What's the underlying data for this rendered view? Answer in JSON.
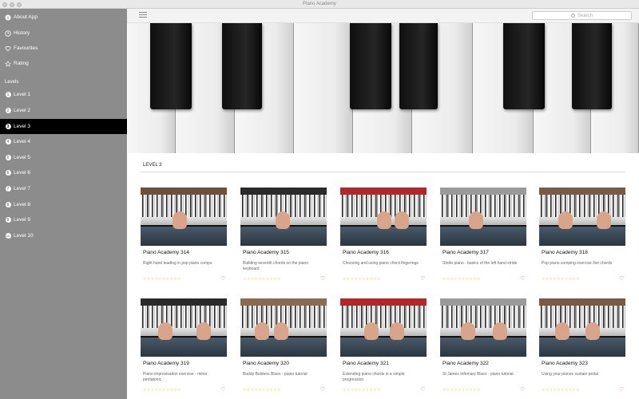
{
  "window": {
    "title": "Piano Academy"
  },
  "toolbar": {
    "search_placeholder": "Search"
  },
  "sidebar": {
    "top_items": [
      {
        "label": "About App",
        "icon": "info-icon"
      },
      {
        "label": "History",
        "icon": "clock-icon"
      },
      {
        "label": "Favourites",
        "icon": "heart-icon"
      },
      {
        "label": "Rating",
        "icon": "star-icon"
      }
    ],
    "levels_header": "Levels",
    "levels": [
      {
        "label": "Level 1",
        "num": "1",
        "active": false
      },
      {
        "label": "Level 2",
        "num": "2",
        "active": false
      },
      {
        "label": "Level 3",
        "num": "3",
        "active": true
      },
      {
        "label": "Level 4",
        "num": "4",
        "active": false
      },
      {
        "label": "Level 5",
        "num": "5",
        "active": false
      },
      {
        "label": "Level 6",
        "num": "6",
        "active": false
      },
      {
        "label": "Level 7",
        "num": "7",
        "active": false
      },
      {
        "label": "Level 8",
        "num": "8",
        "active": false
      },
      {
        "label": "Level 9",
        "num": "9",
        "active": false
      },
      {
        "label": "Level 10",
        "num": "10",
        "active": false
      }
    ]
  },
  "main": {
    "section_title": "LEVEL 3",
    "stars": "☆☆☆☆☆☆☆☆☆☆",
    "fav_symbol": "♡",
    "cards": [
      {
        "title": "Piano Academy 314",
        "description": "Right hand leading in pop piano comps",
        "rating": 0
      },
      {
        "title": "Piano Academy 315",
        "description": "Building seventh chords on the piano keyboard",
        "rating": 0
      },
      {
        "title": "Piano Academy 316",
        "description": "Choosing and using piano chord fingerings",
        "rating": 0
      },
      {
        "title": "Piano Academy 317",
        "description": "Stride piano - basics of the left hand stride",
        "rating": 0
      },
      {
        "title": "Piano Academy 318",
        "description": "Pop piano comping exercise five chords",
        "rating": 0
      },
      {
        "title": "Piano Academy 319",
        "description": "Piano improvisation exercise - minor pentatonic",
        "rating": 0
      },
      {
        "title": "Piano Academy 320",
        "description": "Buddy Boldens Blues - piano tutorial",
        "rating": 0
      },
      {
        "title": "Piano Academy 321",
        "description": "Extending piano chords in a simple progression",
        "rating": 0
      },
      {
        "title": "Piano Academy 322",
        "description": "St James Infirmary Blues - piano tutorial",
        "rating": 0
      },
      {
        "title": "Piano Academy 323",
        "description": "Using your pianos sustain pedal",
        "rating": 0
      }
    ]
  },
  "colors": {
    "sidebar_bg": "#8c8c8c",
    "sidebar_active": "#000000",
    "star": "#d8b400",
    "heart": "#e05555"
  }
}
